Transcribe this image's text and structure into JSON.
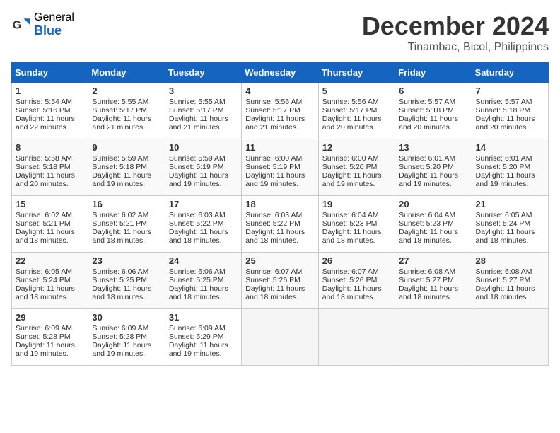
{
  "logo": {
    "general": "General",
    "blue": "Blue"
  },
  "title": "December 2024",
  "location": "Tinambac, Bicol, Philippines",
  "days_of_week": [
    "Sunday",
    "Monday",
    "Tuesday",
    "Wednesday",
    "Thursday",
    "Friday",
    "Saturday"
  ],
  "weeks": [
    [
      {
        "day": 1,
        "sunrise": "5:54 AM",
        "sunset": "5:16 PM",
        "daylight": "11 hours and 22 minutes."
      },
      {
        "day": 2,
        "sunrise": "5:55 AM",
        "sunset": "5:17 PM",
        "daylight": "11 hours and 21 minutes."
      },
      {
        "day": 3,
        "sunrise": "5:55 AM",
        "sunset": "5:17 PM",
        "daylight": "11 hours and 21 minutes."
      },
      {
        "day": 4,
        "sunrise": "5:56 AM",
        "sunset": "5:17 PM",
        "daylight": "11 hours and 21 minutes."
      },
      {
        "day": 5,
        "sunrise": "5:56 AM",
        "sunset": "5:17 PM",
        "daylight": "11 hours and 20 minutes."
      },
      {
        "day": 6,
        "sunrise": "5:57 AM",
        "sunset": "5:18 PM",
        "daylight": "11 hours and 20 minutes."
      },
      {
        "day": 7,
        "sunrise": "5:57 AM",
        "sunset": "5:18 PM",
        "daylight": "11 hours and 20 minutes."
      }
    ],
    [
      {
        "day": 8,
        "sunrise": "5:58 AM",
        "sunset": "5:18 PM",
        "daylight": "11 hours and 20 minutes."
      },
      {
        "day": 9,
        "sunrise": "5:59 AM",
        "sunset": "5:18 PM",
        "daylight": "11 hours and 19 minutes."
      },
      {
        "day": 10,
        "sunrise": "5:59 AM",
        "sunset": "5:19 PM",
        "daylight": "11 hours and 19 minutes."
      },
      {
        "day": 11,
        "sunrise": "6:00 AM",
        "sunset": "5:19 PM",
        "daylight": "11 hours and 19 minutes."
      },
      {
        "day": 12,
        "sunrise": "6:00 AM",
        "sunset": "5:20 PM",
        "daylight": "11 hours and 19 minutes."
      },
      {
        "day": 13,
        "sunrise": "6:01 AM",
        "sunset": "5:20 PM",
        "daylight": "11 hours and 19 minutes."
      },
      {
        "day": 14,
        "sunrise": "6:01 AM",
        "sunset": "5:20 PM",
        "daylight": "11 hours and 19 minutes."
      }
    ],
    [
      {
        "day": 15,
        "sunrise": "6:02 AM",
        "sunset": "5:21 PM",
        "daylight": "11 hours and 18 minutes."
      },
      {
        "day": 16,
        "sunrise": "6:02 AM",
        "sunset": "5:21 PM",
        "daylight": "11 hours and 18 minutes."
      },
      {
        "day": 17,
        "sunrise": "6:03 AM",
        "sunset": "5:22 PM",
        "daylight": "11 hours and 18 minutes."
      },
      {
        "day": 18,
        "sunrise": "6:03 AM",
        "sunset": "5:22 PM",
        "daylight": "11 hours and 18 minutes."
      },
      {
        "day": 19,
        "sunrise": "6:04 AM",
        "sunset": "5:23 PM",
        "daylight": "11 hours and 18 minutes."
      },
      {
        "day": 20,
        "sunrise": "6:04 AM",
        "sunset": "5:23 PM",
        "daylight": "11 hours and 18 minutes."
      },
      {
        "day": 21,
        "sunrise": "6:05 AM",
        "sunset": "5:24 PM",
        "daylight": "11 hours and 18 minutes."
      }
    ],
    [
      {
        "day": 22,
        "sunrise": "6:05 AM",
        "sunset": "5:24 PM",
        "daylight": "11 hours and 18 minutes."
      },
      {
        "day": 23,
        "sunrise": "6:06 AM",
        "sunset": "5:25 PM",
        "daylight": "11 hours and 18 minutes."
      },
      {
        "day": 24,
        "sunrise": "6:06 AM",
        "sunset": "5:25 PM",
        "daylight": "11 hours and 18 minutes."
      },
      {
        "day": 25,
        "sunrise": "6:07 AM",
        "sunset": "5:26 PM",
        "daylight": "11 hours and 18 minutes."
      },
      {
        "day": 26,
        "sunrise": "6:07 AM",
        "sunset": "5:26 PM",
        "daylight": "11 hours and 18 minutes."
      },
      {
        "day": 27,
        "sunrise": "6:08 AM",
        "sunset": "5:27 PM",
        "daylight": "11 hours and 18 minutes."
      },
      {
        "day": 28,
        "sunrise": "6:08 AM",
        "sunset": "5:27 PM",
        "daylight": "11 hours and 18 minutes."
      }
    ],
    [
      {
        "day": 29,
        "sunrise": "6:09 AM",
        "sunset": "5:28 PM",
        "daylight": "11 hours and 19 minutes."
      },
      {
        "day": 30,
        "sunrise": "6:09 AM",
        "sunset": "5:28 PM",
        "daylight": "11 hours and 19 minutes."
      },
      {
        "day": 31,
        "sunrise": "6:09 AM",
        "sunset": "5:29 PM",
        "daylight": "11 hours and 19 minutes."
      },
      null,
      null,
      null,
      null
    ]
  ]
}
